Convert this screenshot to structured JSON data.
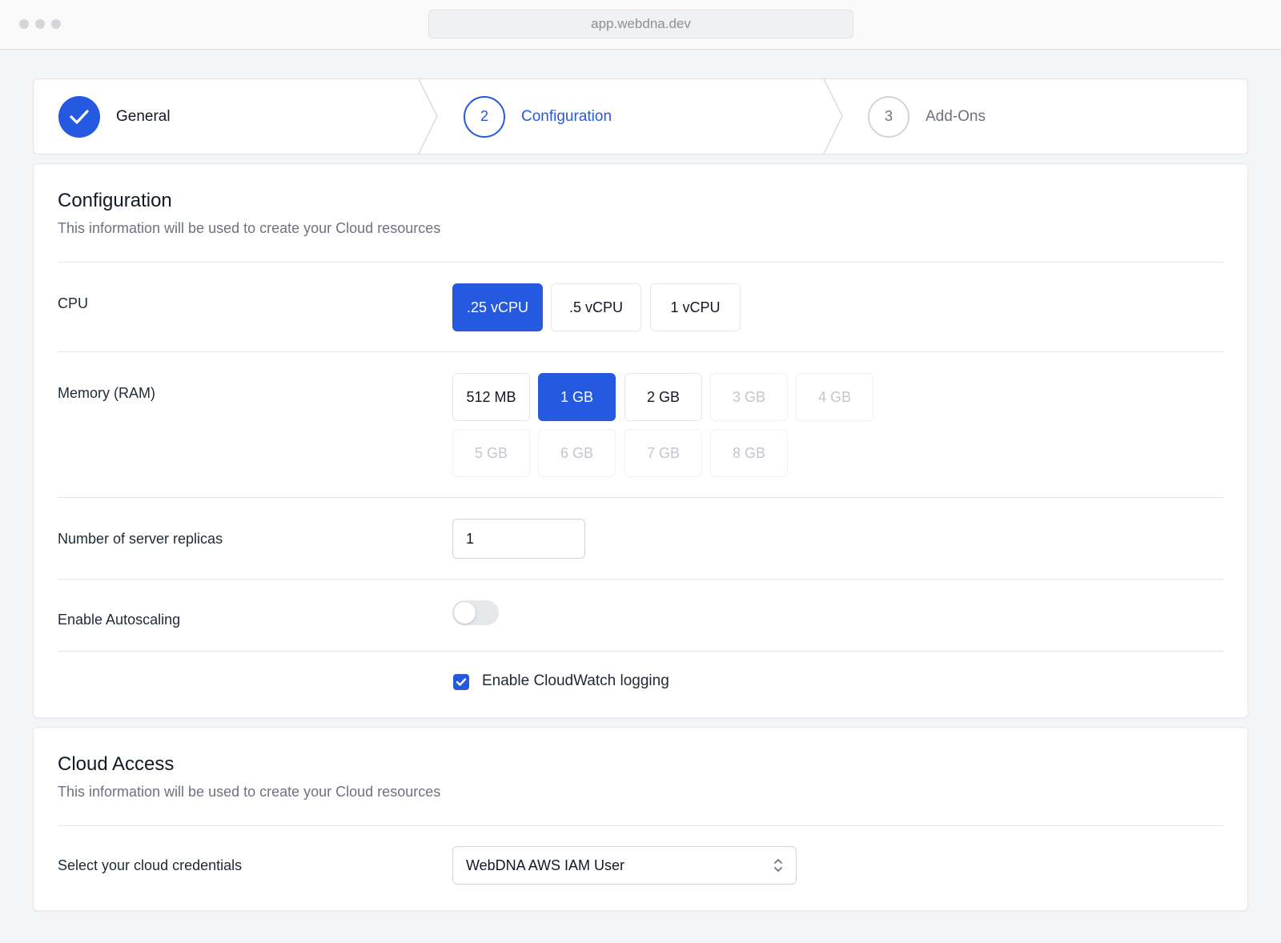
{
  "browser": {
    "url": "app.webdna.dev"
  },
  "stepper": {
    "steps": [
      {
        "number": "",
        "label": "General",
        "state": "complete"
      },
      {
        "number": "2",
        "label": "Configuration",
        "state": "current"
      },
      {
        "number": "3",
        "label": "Add-Ons",
        "state": "upcoming"
      }
    ]
  },
  "configuration": {
    "title": "Configuration",
    "subtitle": "This information will be used to create your Cloud resources",
    "cpu": {
      "label": "CPU",
      "options": [
        {
          "label": ".25 vCPU",
          "selected": true,
          "disabled": false
        },
        {
          "label": ".5 vCPU",
          "selected": false,
          "disabled": false
        },
        {
          "label": "1 vCPU",
          "selected": false,
          "disabled": false
        }
      ]
    },
    "memory": {
      "label": "Memory (RAM)",
      "options": [
        {
          "label": "512 MB",
          "selected": false,
          "disabled": false
        },
        {
          "label": "1 GB",
          "selected": true,
          "disabled": false
        },
        {
          "label": "2 GB",
          "selected": false,
          "disabled": false
        },
        {
          "label": "3 GB",
          "selected": false,
          "disabled": true
        },
        {
          "label": "4 GB",
          "selected": false,
          "disabled": true
        },
        {
          "label": "5 GB",
          "selected": false,
          "disabled": true
        },
        {
          "label": "6 GB",
          "selected": false,
          "disabled": true
        },
        {
          "label": "7 GB",
          "selected": false,
          "disabled": true
        },
        {
          "label": "8 GB",
          "selected": false,
          "disabled": true
        }
      ]
    },
    "replicas": {
      "label": "Number of server replicas",
      "value": "1"
    },
    "autoscaling": {
      "label": "Enable Autoscaling",
      "enabled": false
    },
    "cloudwatch": {
      "label": "Enable CloudWatch logging",
      "checked": true
    }
  },
  "cloud_access": {
    "title": "Cloud Access",
    "subtitle": "This information will be used to create your Cloud resources",
    "credentials": {
      "label": "Select your cloud credentials",
      "value": "WebDNA AWS IAM User"
    }
  },
  "colors": {
    "accent": "#2459e0",
    "disabled_text": "#c3c7cd",
    "muted_text": "#6b7280"
  },
  "icons": {
    "complete_step": "check-icon",
    "select": "chevron-up-down-icon",
    "checkbox": "check-icon"
  }
}
